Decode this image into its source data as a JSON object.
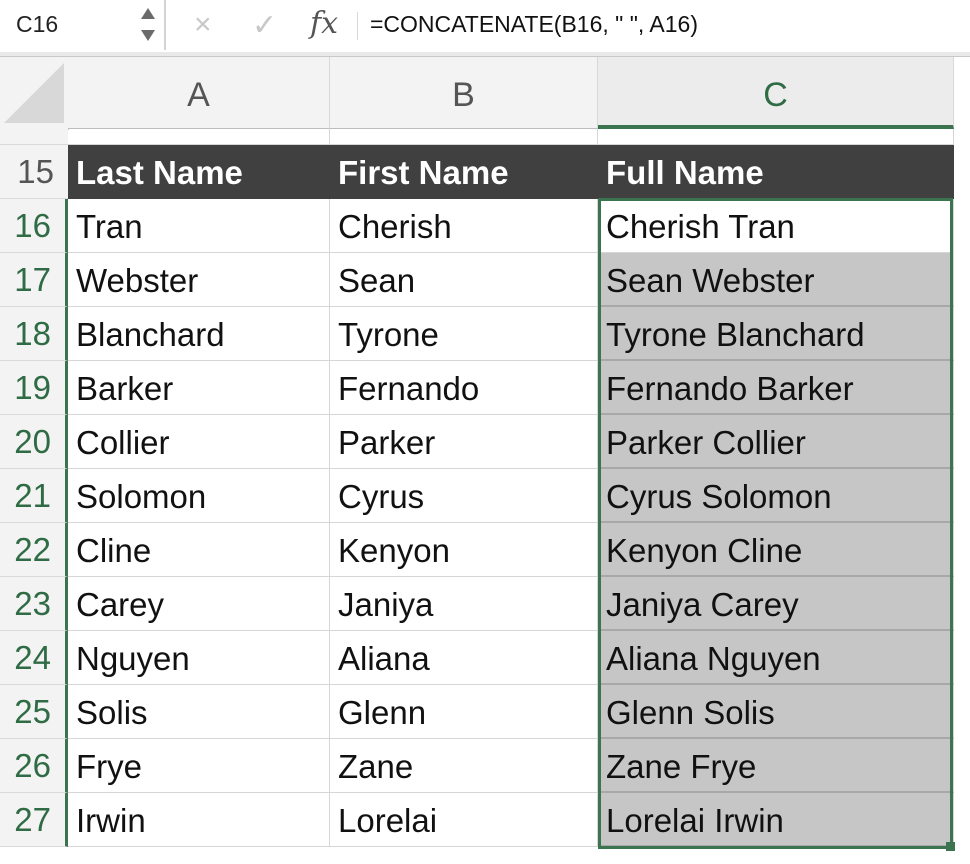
{
  "formula_bar": {
    "name_box": "C16",
    "cancel_icon": "×",
    "enter_icon": "✓",
    "fx_label": "fx",
    "formula": "=CONCATENATE(B16, \" \", A16)"
  },
  "columns": [
    {
      "label": "A",
      "selected": false
    },
    {
      "label": "B",
      "selected": false
    },
    {
      "label": "C",
      "selected": true
    }
  ],
  "rows": [
    {
      "num": "15",
      "a": "Last Name",
      "b": "First Name",
      "c": "Full Name",
      "header": true
    },
    {
      "num": "16",
      "a": "Tran",
      "b": "Cherish",
      "c": "Cherish Tran"
    },
    {
      "num": "17",
      "a": "Webster",
      "b": "Sean",
      "c": "Sean Webster"
    },
    {
      "num": "18",
      "a": "Blanchard",
      "b": "Tyrone",
      "c": "Tyrone Blanchard"
    },
    {
      "num": "19",
      "a": "Barker",
      "b": "Fernando",
      "c": "Fernando Barker"
    },
    {
      "num": "20",
      "a": "Collier",
      "b": "Parker",
      "c": "Parker Collier"
    },
    {
      "num": "21",
      "a": "Solomon",
      "b": "Cyrus",
      "c": "Cyrus Solomon"
    },
    {
      "num": "22",
      "a": "Cline",
      "b": "Kenyon",
      "c": "Kenyon Cline"
    },
    {
      "num": "23",
      "a": "Carey",
      "b": "Janiya",
      "c": "Janiya Carey"
    },
    {
      "num": "24",
      "a": "Nguyen",
      "b": "Aliana",
      "c": "Aliana Nguyen"
    },
    {
      "num": "25",
      "a": "Solis",
      "b": "Glenn",
      "c": "Glenn Solis"
    },
    {
      "num": "26",
      "a": "Frye",
      "b": "Zane",
      "c": "Zane Frye"
    },
    {
      "num": "27",
      "a": "Irwin",
      "b": "Lorelai",
      "c": "Lorelai Irwin"
    }
  ],
  "selection": {
    "active_cell": "C16",
    "range": "C16:C27"
  },
  "colors": {
    "accent": "#3c744f",
    "header_fill": "#404040",
    "highlight_fill": "#c6c6c6"
  }
}
